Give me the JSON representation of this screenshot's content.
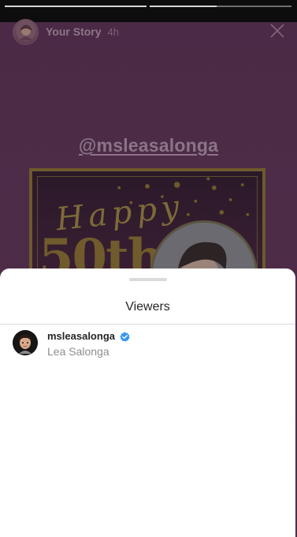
{
  "story": {
    "username": "Your Story",
    "time": "4h",
    "mention": "@msleasalonga",
    "card_text_top": "Happy",
    "card_text_bottom": "50th"
  },
  "progress_bars": [
    {
      "fill": 1.0
    },
    {
      "fill": 0.47
    }
  ],
  "icons": {
    "close": "close-icon",
    "verified": "verified-badge-icon"
  },
  "viewers_sheet": {
    "title": "Viewers",
    "viewers": [
      {
        "username": "msleasalonga",
        "full_name": "Lea Salonga",
        "verified": true
      }
    ]
  },
  "colors": {
    "sheet_bg": "#ffffff",
    "verified_blue": "#3897f0",
    "secondary_text": "#8e8e8e"
  }
}
